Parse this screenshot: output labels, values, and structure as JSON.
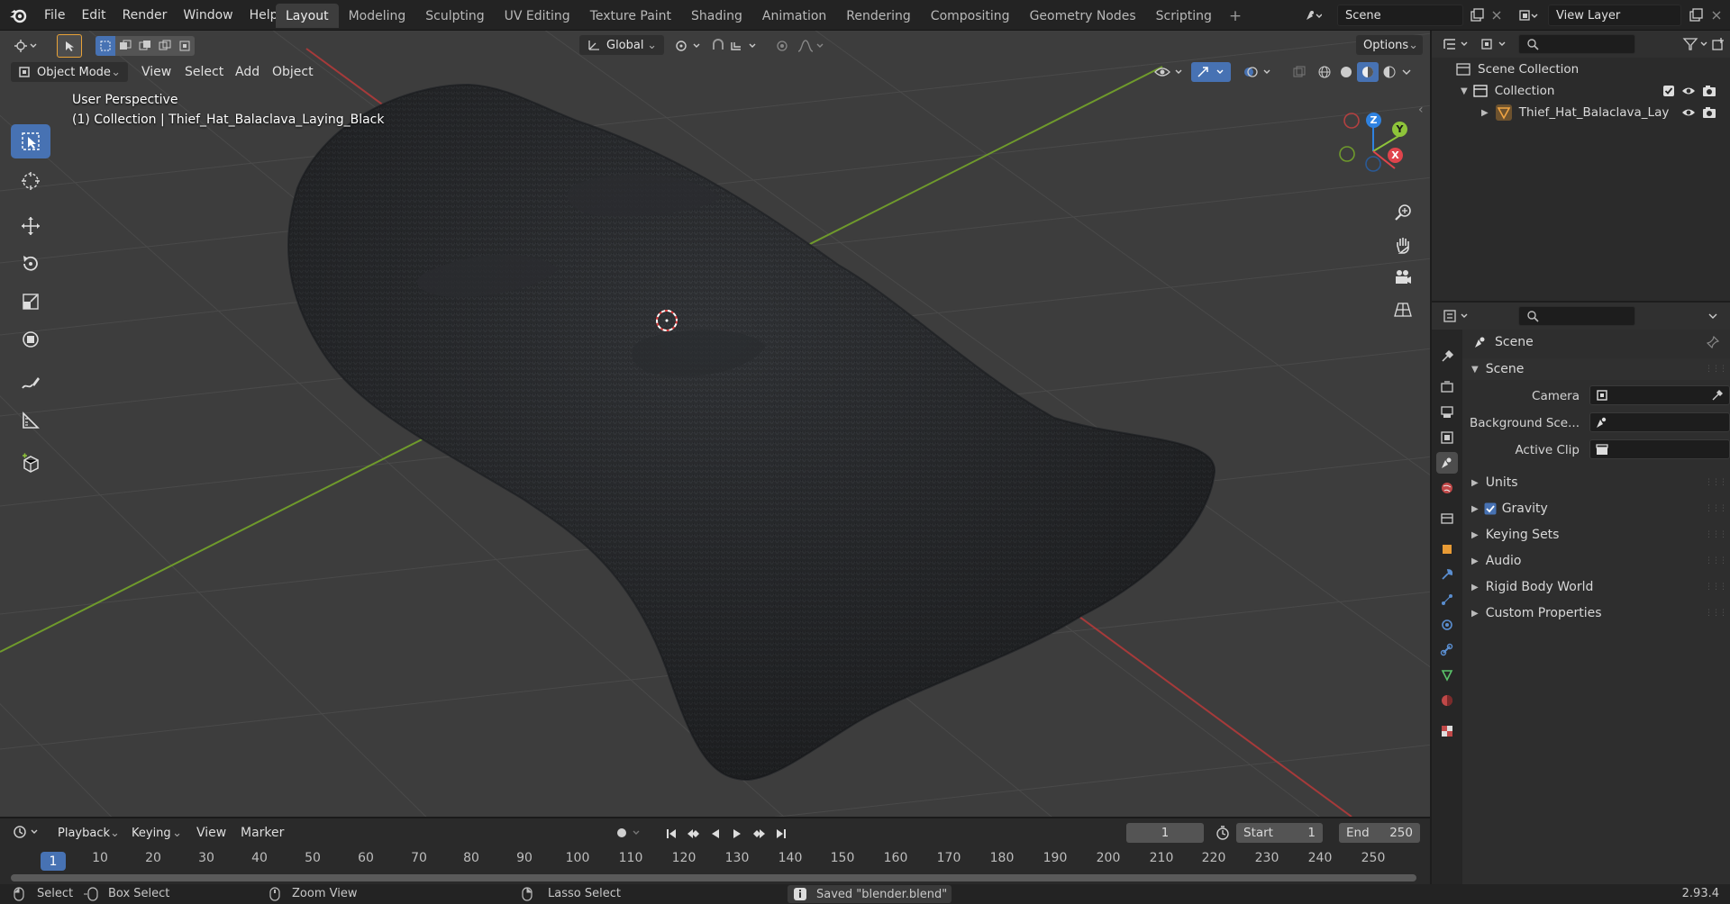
{
  "menubar": {
    "menus": [
      "File",
      "Edit",
      "Render",
      "Window",
      "Help"
    ],
    "workspace_tabs": [
      "Layout",
      "Modeling",
      "Sculpting",
      "UV Editing",
      "Texture Paint",
      "Shading",
      "Animation",
      "Rendering",
      "Compositing",
      "Geometry Nodes",
      "Scripting"
    ],
    "active_tab": "Layout",
    "scene_name": "Scene",
    "view_layer_name": "View Layer"
  },
  "viewport": {
    "mode": "Object Mode",
    "menus": [
      "View",
      "Select",
      "Add",
      "Object"
    ],
    "transform_orientation": "Global",
    "options_label": "Options",
    "overlay_line1": "User Perspective",
    "overlay_line2": "(1) Collection | Thief_Hat_Balaclava_Laying_Black",
    "gizmo_axes": [
      "X",
      "Y",
      "Z"
    ],
    "colors": {
      "x_axis": "#e0444c",
      "y_axis": "#8ec43a",
      "z_axis": "#2f82e0",
      "grid_bg": "#3d3d3d",
      "accent": "#4772b3"
    }
  },
  "timeline": {
    "menus": [
      "Playback",
      "Keying",
      "View",
      "Marker"
    ],
    "current_frame": "1",
    "start_label": "Start",
    "start": "1",
    "end_label": "End",
    "end": "250",
    "frame_marks": [
      "10",
      "20",
      "30",
      "40",
      "50",
      "60",
      "70",
      "80",
      "90",
      "100",
      "110",
      "120",
      "130",
      "140",
      "150",
      "160",
      "170",
      "180",
      "190",
      "200",
      "210",
      "220",
      "230",
      "240",
      "250"
    ]
  },
  "statusbar": {
    "select": "Select",
    "box_select": "Box Select",
    "zoom_view": "Zoom View",
    "lasso_select": "Lasso Select",
    "message": "Saved \"blender.blend\"",
    "version": "2.93.4"
  },
  "outliner": {
    "root": "Scene Collection",
    "collection": "Collection",
    "object": "Thief_Hat_Balaclava_Lay"
  },
  "properties": {
    "context_title": "Scene",
    "panel_title": "Scene",
    "camera_label": "Camera",
    "background_label": "Background Sce...",
    "active_clip_label": "Active Clip",
    "collapsed_panels": [
      "Units",
      "Gravity",
      "Keying Sets",
      "Audio",
      "Rigid Body World",
      "Custom Properties"
    ],
    "gravity_enabled": true
  }
}
